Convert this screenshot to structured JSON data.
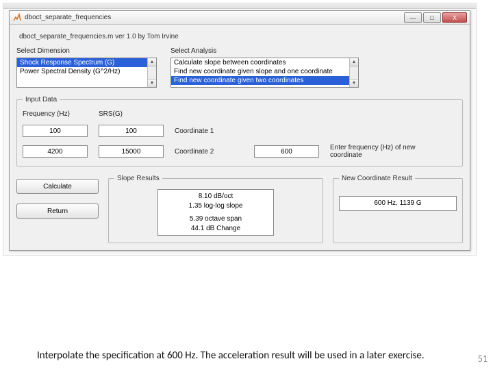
{
  "window": {
    "title": "dboct_separate_frequencies",
    "btn_min": "—",
    "btn_max": "□",
    "btn_close": "X"
  },
  "program_title": "dboct_separate_frequencies.m ver 1.0  by Tom Irvine",
  "dimension": {
    "label": "Select Dimension",
    "items": {
      "0": "Shock Response Spectrum (G)",
      "1": "Power Spectral Density (G^2/Hz)"
    }
  },
  "analysis": {
    "label": "Select Analysis",
    "items": {
      "0": "Calculate slope between coordinates",
      "1": "Find new coordinate given slope and one coordinate",
      "2": "Find new coordinate given two coordinates"
    }
  },
  "input_data": {
    "legend": "Input Data",
    "hdr_freq": "Frequency (Hz)",
    "hdr_srs": "SRS(G)",
    "row1_freq": "100",
    "row1_srs": "100",
    "row1_lbl": "Coordinate 1",
    "row2_freq": "4200",
    "row2_srs": "15000",
    "row2_lbl": "Coordinate 2",
    "new_freq": "600",
    "new_freq_lbl": "Enter frequency (Hz) of new coordinate"
  },
  "buttons": {
    "calculate": "Calculate",
    "return": "Return"
  },
  "slope_results": {
    "legend": "Slope Results",
    "line1": "8.10 dB/oct",
    "line2": "1.35 log-log slope",
    "line3": "5.39 octave span",
    "line4": "44.1 dB Change"
  },
  "new_coord_result": {
    "legend": "New Coordinate Result",
    "value": "600 Hz,      1139 G"
  },
  "caption": "Interpolate the specification at 600 Hz. The acceleration result will be used in a later exercise.",
  "page_number": "51",
  "scroll": {
    "up": "▲",
    "down": "▼"
  }
}
